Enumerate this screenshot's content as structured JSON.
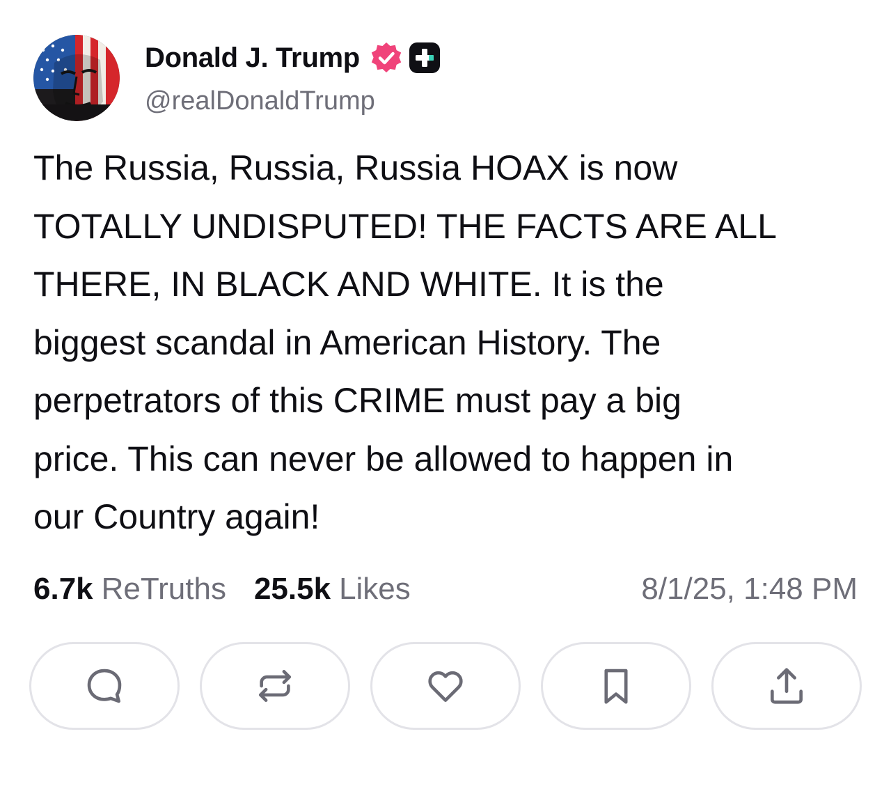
{
  "author": {
    "display_name": "Donald J. Trump",
    "handle": "@realDonaldTrump",
    "avatar_icon": "flag-face-avatar",
    "verified_icon": "verified-badge-icon",
    "verified_color": "#f0437a",
    "plus_icon": "truth-plus-badge-icon"
  },
  "post": {
    "text": "The Russia, Russia, Russia HOAX is now\nTOTALLY  UNDISPUTED! THE FACTS ARE ALL\nTHERE, IN BLACK AND WHITE. It is the\nbiggest scandal in American History. The\nperpetrators of this CRIME must pay a big\nprice. This can never be allowed to happen in\nour Country again!"
  },
  "stats": {
    "retruths_count": "6.7k",
    "retruths_label": "ReTruths",
    "likes_count": "25.5k",
    "likes_label": "Likes",
    "timestamp": "8/1/25, 1:48 PM"
  },
  "actions": [
    {
      "name": "reply",
      "icon": "comment-icon"
    },
    {
      "name": "retruth",
      "icon": "repost-icon"
    },
    {
      "name": "like",
      "icon": "heart-icon"
    },
    {
      "name": "bookmark",
      "icon": "bookmark-icon"
    },
    {
      "name": "share",
      "icon": "share-icon"
    }
  ],
  "colors": {
    "text": "#0f0f14",
    "muted": "#6e6e78",
    "button_border": "#e3e3e8",
    "icon": "#6b6b75"
  }
}
